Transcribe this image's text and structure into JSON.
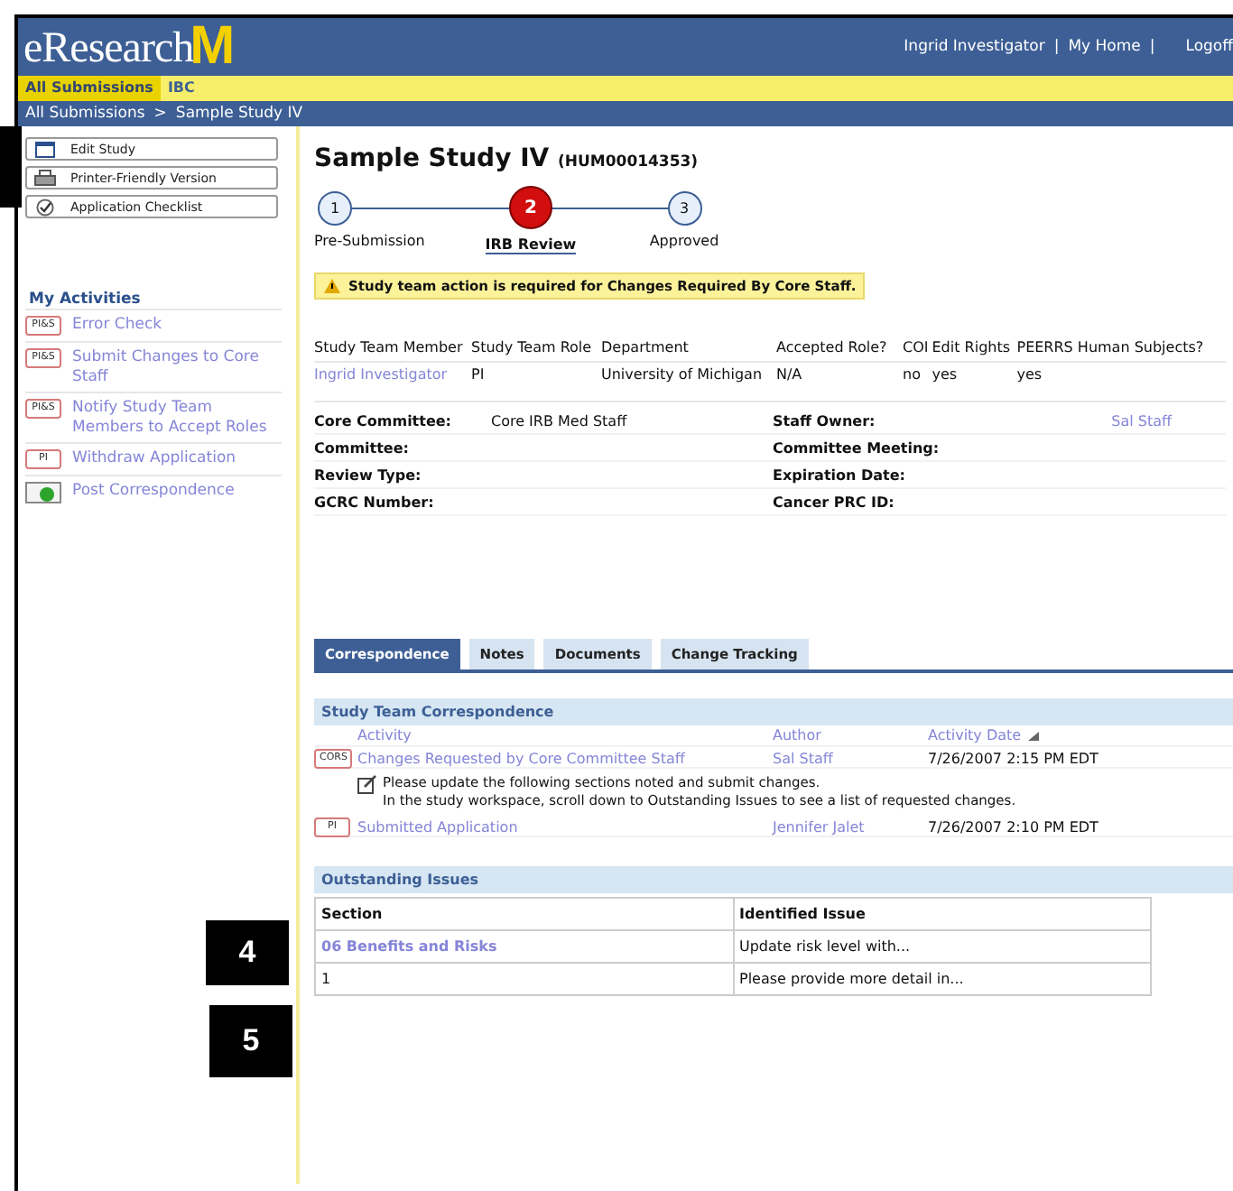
{
  "header": {
    "logo_text": "eResearch",
    "logo_mark": "M",
    "user_links": [
      "Ingrid Investigator",
      "My Home",
      "Logoff"
    ],
    "separator": "|"
  },
  "nav_tabs": [
    {
      "label": "All Submissions",
      "selected": true
    },
    {
      "label": "IBC",
      "selected": false
    }
  ],
  "breadcrumb": {
    "items": [
      "All Submissions",
      "Sample Study IV"
    ],
    "separator": ">"
  },
  "sidebar": {
    "buttons": [
      {
        "label": "Edit Study",
        "kind": "window"
      },
      {
        "label": "Printer-Friendly Version",
        "kind": "printer"
      },
      {
        "label": "Application Checklist",
        "kind": "check"
      }
    ],
    "activities_title": "My Activities",
    "activities": [
      {
        "kind": "badge",
        "badge": "PI&S",
        "label": "Error Check"
      },
      {
        "kind": "badge",
        "badge": "PI&S",
        "label": "Submit Changes to Core Staff"
      },
      {
        "kind": "badge",
        "badge": "PI&S",
        "label": "Notify Study Team Members to Accept Roles"
      },
      {
        "kind": "badge",
        "badge": "PI",
        "label": "Withdraw Application"
      },
      {
        "kind": "mail",
        "label": "Post Correspondence"
      }
    ]
  },
  "study": {
    "title": "Sample Study IV",
    "id": "(HUM00014353)"
  },
  "steps": [
    {
      "number": "1",
      "label": "Pre-Submission",
      "selected": false
    },
    {
      "number": "2",
      "label": "IRB Review",
      "selected": true
    },
    {
      "number": "3",
      "label": "Approved",
      "selected": false
    }
  ],
  "alert": "Study team action is required for Changes Required By Core Staff.",
  "team_table": {
    "columns": [
      "Study Team Member",
      "Study Team Role",
      "Department",
      "Accepted Role?",
      "COI",
      "Edit Rights",
      "PEERRS Human Subjects?"
    ],
    "rows": [
      [
        "Ingrid Investigator",
        "PI",
        "University of Michigan",
        "N/A",
        "no",
        "yes",
        "yes"
      ]
    ]
  },
  "details": [
    {
      "label": "Core Committee:",
      "value": "Core IRB Med Staff"
    },
    {
      "label": "Staff Owner:",
      "value": "Sal Staff",
      "link": true
    },
    {
      "label": "Committee:"
    },
    {
      "label": "Committee Meeting:"
    },
    {
      "label": "Review Type:"
    },
    {
      "label": "Expiration Date:"
    },
    {
      "label": "GCRC Number:"
    },
    {
      "label": "Cancer PRC ID:"
    }
  ],
  "tabs": [
    {
      "label": "Correspondence",
      "selected": true
    },
    {
      "label": "Notes",
      "selected": false
    },
    {
      "label": "Documents",
      "selected": false
    },
    {
      "label": "Change Tracking",
      "selected": false
    }
  ],
  "correspondence": {
    "title": "Study Team Correspondence",
    "columns": [
      "Activity",
      "Author",
      "Activity Date"
    ],
    "rows": [
      {
        "badge": "CORS",
        "activity": "Changes Requested by Core Committee Staff",
        "author": "Sal Staff",
        "date": "7/26/2007 2:15 PM EDT",
        "note": [
          "Please update the following sections noted and submit changes.",
          "In the study workspace, scroll down to Outstanding Issues to see a list of requested changes."
        ]
      },
      {
        "badge": "PI",
        "activity": "Submitted Application",
        "author": "Jennifer Jalet",
        "date": "7/26/2007 2:10 PM EDT"
      }
    ]
  },
  "outstanding": {
    "title": "Outstanding Issues",
    "columns": [
      "Section",
      "Identified Issue"
    ],
    "rows": [
      {
        "section": "06 Benefits and Risks",
        "link": true,
        "issue": "Update risk level with..."
      },
      {
        "section": "1",
        "link": false,
        "issue": "Please provide more detail in..."
      }
    ]
  },
  "callouts": [
    "4",
    "5"
  ]
}
